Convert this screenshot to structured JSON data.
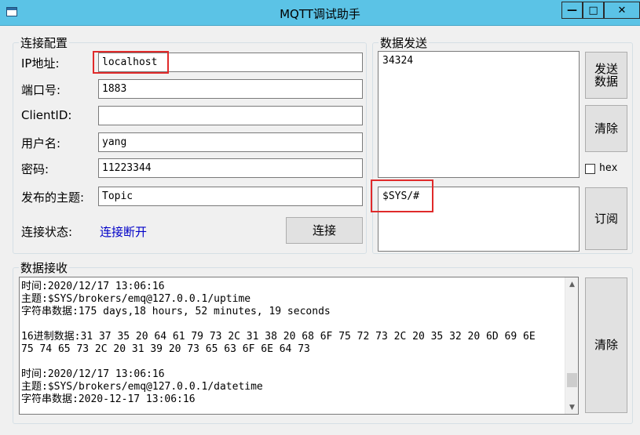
{
  "window": {
    "title": "MQTT调试助手",
    "min_label": "—",
    "max_label": "□",
    "close_label": "✕"
  },
  "connection": {
    "group_label": "连接配置",
    "ip_label": "IP地址:",
    "ip_value": "localhost",
    "port_label": "端口号:",
    "port_value": "1883",
    "clientid_label": "ClientID:",
    "clientid_value": "",
    "username_label": "用户名:",
    "username_value": "yang",
    "password_label": "密码:",
    "password_value": "11223344",
    "topic_label": "发布的主题:",
    "topic_value": "Topic",
    "status_label": "连接状态:",
    "status_value": "连接断开",
    "connect_button": "连接"
  },
  "send": {
    "group_label": "数据发送",
    "send_text": "34324",
    "send_button": "发送\n数据",
    "clear_button": "清除",
    "hex_label": "hex",
    "subscribe_topic": "$SYS/#",
    "subscribe_button": "订阅"
  },
  "receive": {
    "group_label": "数据接收",
    "clear_button": "清除",
    "lines": [
      "时间:2020/12/17 13:06:16",
      "主题:$SYS/brokers/emq@127.0.0.1/uptime",
      "字符串数据:175 days,18 hours, 52 minutes, 19 seconds",
      "",
      "16进制数据:31 37 35 20 64 61 79 73 2C 31 38 20 68 6F 75 72 73 2C 20 35 32 20 6D 69 6E",
      "75 74 65 73 2C 20 31 39 20 73 65 63 6F 6E 64 73",
      "",
      "时间:2020/12/17 13:06:16",
      "主题:$SYS/brokers/emq@127.0.0.1/datetime",
      "字符串数据:2020-12-17 13:06:16"
    ],
    "scroll_up": "▲",
    "scroll_down": "▼"
  }
}
